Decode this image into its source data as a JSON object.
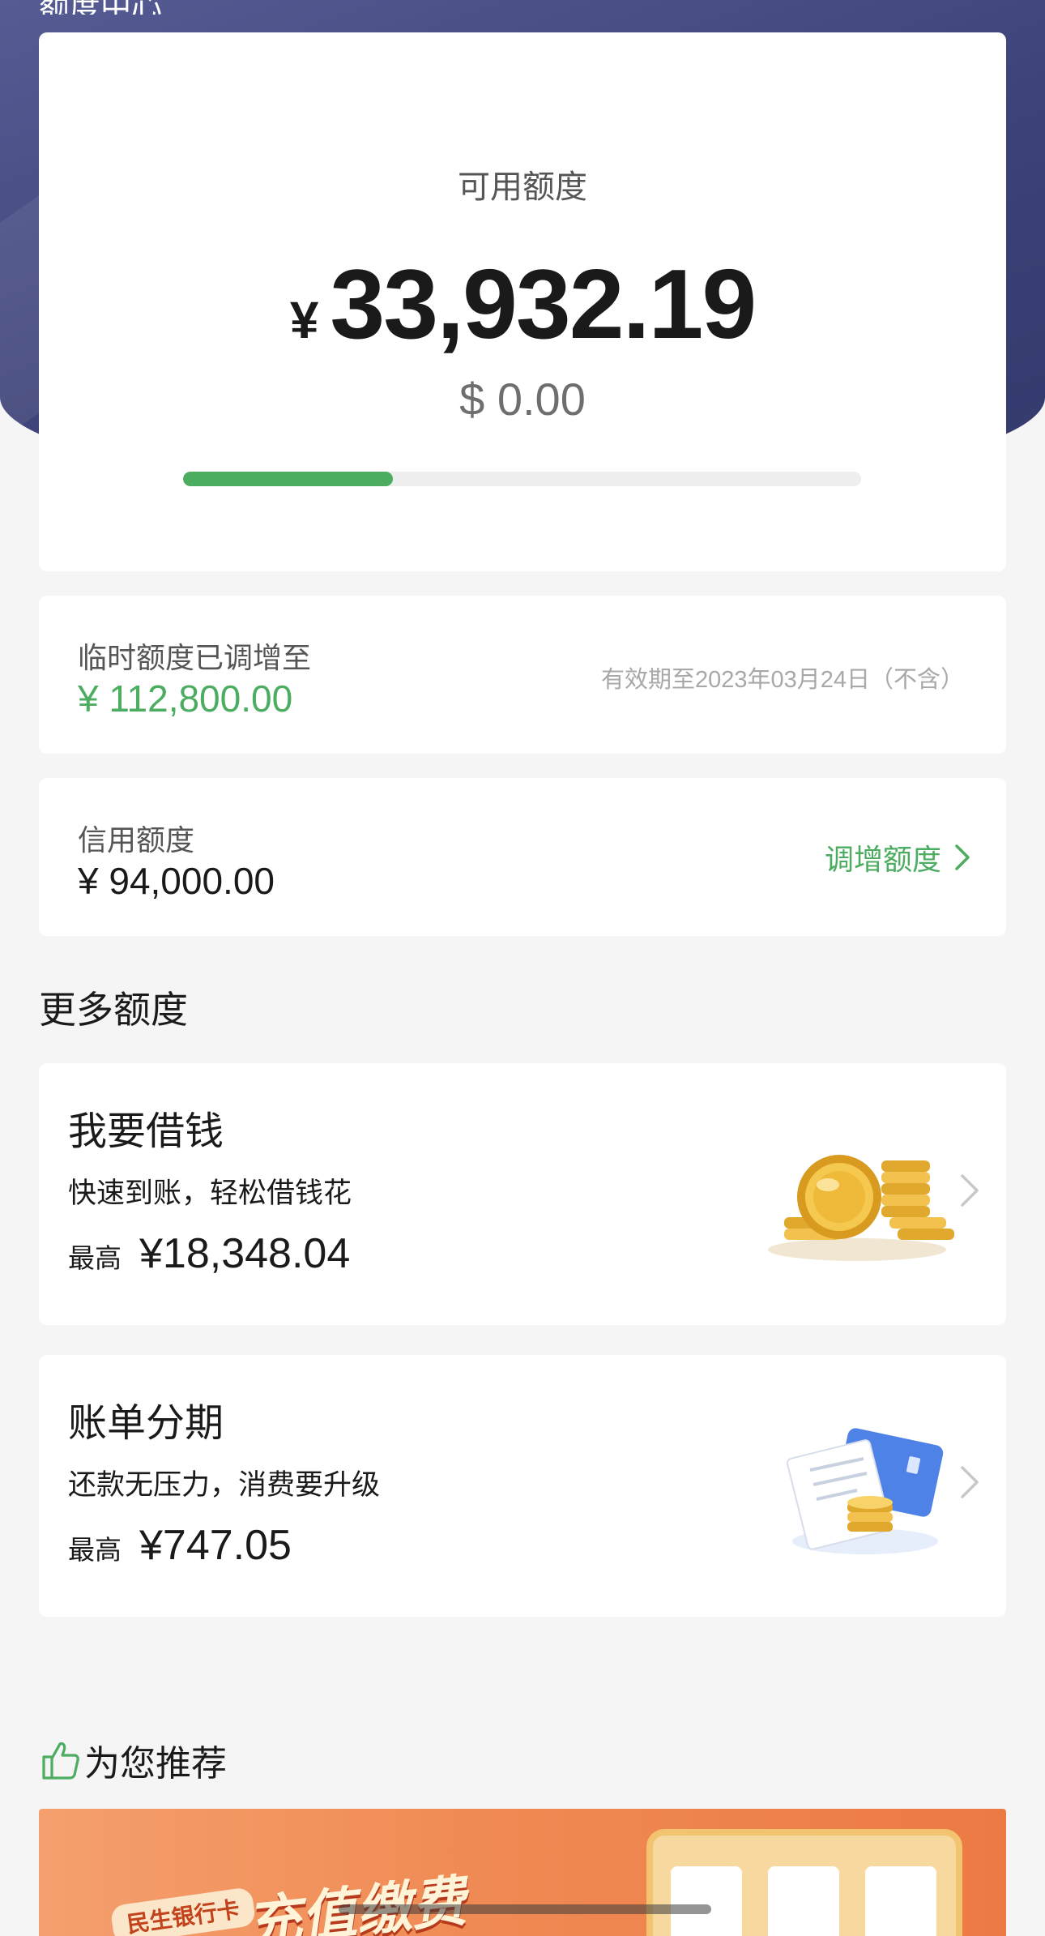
{
  "header": {
    "title": "额度中心"
  },
  "summary": {
    "label": "可用额度",
    "currency_symbol": "¥",
    "amount": "33,932.19",
    "usd_amount": "$ 0.00",
    "usage_fraction": 0.31
  },
  "temporary_limit": {
    "label": "临时额度已调增至",
    "value": "¥ 112,800.00",
    "validity": "有效期至2023年03月24日（不含）"
  },
  "credit_limit": {
    "label": "信用额度",
    "value": "¥ 94,000.00",
    "action_label": "调增额度"
  },
  "more_limits": {
    "title": "更多额度",
    "items": [
      {
        "title": "我要借钱",
        "desc": "快速到账，轻松借钱花",
        "max_label": "最高",
        "max_value": "¥18,348.04",
        "icon": "gold-coins-icon"
      },
      {
        "title": "账单分期",
        "desc": "还款无压力，消费要升级",
        "max_label": "最高",
        "max_value": "¥747.05",
        "icon": "bill-card-icon"
      }
    ]
  },
  "recommend": {
    "title": "为您推荐",
    "icon": "thumbs-up-icon",
    "banner": {
      "tag": "民生银行卡",
      "headline": "充值缴费"
    }
  },
  "colors": {
    "accent_green": "#4cac60",
    "hero_bg": "#3d4277",
    "banner_orange": "#f08a54"
  }
}
